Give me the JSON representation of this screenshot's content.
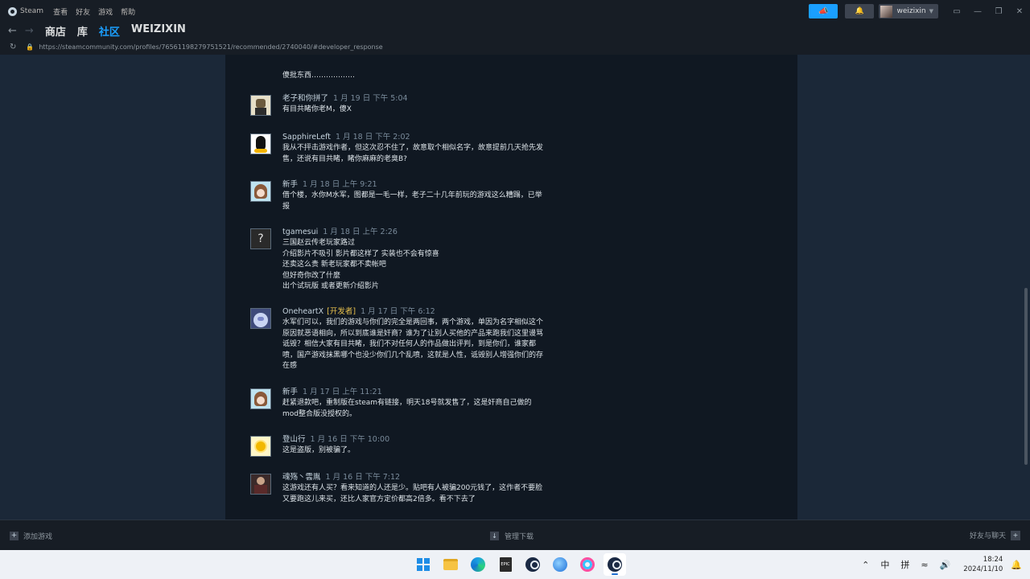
{
  "titlebar": {
    "app_name": "Steam",
    "menu": [
      "查看",
      "好友",
      "游戏",
      "帮助"
    ],
    "username": "weizixin"
  },
  "nav": {
    "tabs": [
      "商店",
      "库",
      "社区",
      "WEIZIXIN"
    ],
    "active_tab": "社区"
  },
  "url": "https://steamcommunity.com/profiles/76561198279751521/recommended/2740040/#developer_response",
  "top_text": "傻批东西………………",
  "comments": [
    {
      "name": "老子和你拼了",
      "dev_tag": "",
      "date": "1 月 19 日 下午 5:04",
      "text": "有目共睹你老M，傻X",
      "avatar": "avatar-1"
    },
    {
      "name": "SapphireLeft",
      "dev_tag": "",
      "date": "1 月 18 日 下午 2:02",
      "text": "我从不抨击游戏作者，但这次忍不住了，故意取个相似名字，故意提前几天抢先发\n售，还说有目共睹，睹你麻麻的老臭B?",
      "avatar": "avatar-2"
    },
    {
      "name": "新手",
      "dev_tag": "",
      "date": "1 月 18 日 上午 9:21",
      "text": "借个楼，水你M水军，图都是一毛一样，老子二十几年前玩的游戏这么糟蹋，已举\n报",
      "avatar": "avatar-3"
    },
    {
      "name": "tgamesui",
      "dev_tag": "",
      "date": "1 月 18 日 上午 2:26",
      "text": "三国赵云传老玩家路过\n介绍影片不吸引 影片都这样了 实装也不会有惊喜\n还卖这么贵 新老玩家都不卖帐吧\n但好奇你改了什麼\n出个试玩版 或者更新介绍影片",
      "avatar": "avatar-4"
    },
    {
      "name": "OneheartX",
      "dev_tag": "[开发者]",
      "date": "1 月 17 日 下午 6:12",
      "text": "水军们可以，我们的游戏与你们的完全是两回事，两个游戏，单因为名字相似这个\n原因就恶语相向，所以到底谁是奸商？谁为了让别人买他的产品来跑我们这里谩骂\n诋毁？相信大家有目共睹，我们不对任何人的作品做出评判，到是你们，谁家都\n喷，国产游戏抹黑哪个也没少你们几个乱喷，这就是人性，诋毁别人增强你们的存\n在感",
      "avatar": "avatar-5"
    },
    {
      "name": "新手",
      "dev_tag": "",
      "date": "1 月 17 日 上午 11:21",
      "text": "赶紧退款吧，重制版在steam有链接，明天18号就发售了，这是奸商自己做的\nmod整合版没授权的。",
      "avatar": "avatar-3"
    },
    {
      "name": "登山行",
      "dev_tag": "",
      "date": "1 月 16 日 下午 10:00",
      "text": "这是盗版，别被骗了。",
      "avatar": "avatar-6"
    },
    {
      "name": "魂殇丶雲胤",
      "dev_tag": "",
      "date": "1 月 16 日 下午 7:12",
      "text": "这游戏还有人买？看来知道的人还是少。贴吧有人被骗200元钱了，这作者不要脸\n又要跑这儿来买，还比人家官方定价都高2倍多。看不下去了",
      "avatar": "avatar-7"
    }
  ],
  "bottombar": {
    "add_game": "添加游戏",
    "manage_downloads": "管理下载",
    "friends_chat": "好友与聊天"
  },
  "taskbar": {
    "ime_lang": "中",
    "ime_mode": "拼",
    "time": "18:24",
    "date": "2024/11/10",
    "epic_label": "EPIC"
  }
}
